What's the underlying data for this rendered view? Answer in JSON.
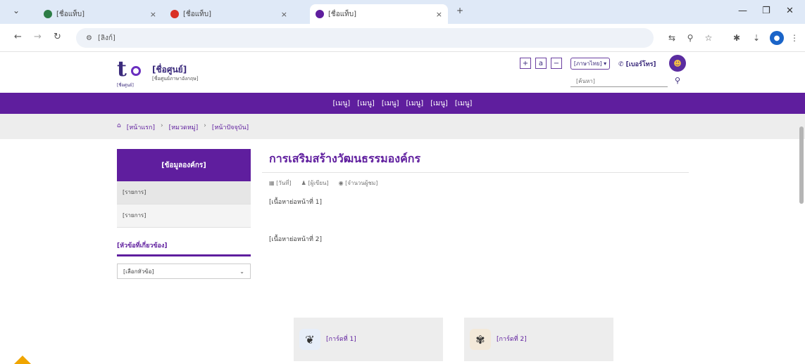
{
  "browser": {
    "tabs": [
      {
        "label": "[ชื่อแท็บ]",
        "favicon_color": "#2d7d46"
      },
      {
        "label": "[ชื่อแท็บ]",
        "favicon_color": "#d93025"
      },
      {
        "label": "[ชื่อแท็บ]",
        "favicon_color": "#5f1e9e"
      }
    ],
    "tab_close": "×",
    "new_tab": "+",
    "tab_search": "⌄",
    "window_min": "—",
    "window_max": "❐",
    "window_close": "✕",
    "url": "[ลิงก์]",
    "profile_initial": "●"
  },
  "site": {
    "logo_letter": "t",
    "logo_caption": "[ชื่อศูนย์]",
    "title": "[ชื่อศูนย์]",
    "subtitle": "[ชื่อศูนย์ภาษาอังกฤษ]",
    "font_controls": [
      "+",
      "a",
      "−"
    ],
    "language": "[ภาษาไทย] ▾",
    "hotline": "✆ [เบอร์โทร]",
    "search_placeholder": "[ค้นหา]",
    "nav": [
      "[เมนู]",
      "[เมนู]",
      "[เมนู]",
      "[เมนู]",
      "[เมนู]",
      "[เมนู]"
    ]
  },
  "breadcrumb": {
    "items": [
      "[หน้าแรก]",
      "[หมวดหมู่]",
      "[หน้าปัจจุบัน]"
    ]
  },
  "sidebar": {
    "heading": "[ข้อมูลองค์กร]",
    "items": [
      "[รายการ]",
      "[รายการ]"
    ],
    "related_label": "[หัวข้อที่เกี่ยวข้อง]",
    "select_value": "[เลือกหัวข้อ]"
  },
  "article": {
    "title": "การเสริมสร้างวัฒนธรรมองค์กร",
    "date": "[วันที่]",
    "author": "[ผู้เขียน]",
    "views": "[จำนวนผู้ชม]",
    "paragraph1": "[เนื้อหาย่อหน้าที่ 1]",
    "paragraph2": "[เนื้อหาย่อหน้าที่ 2]",
    "cards": [
      {
        "label": "[การ์ดที่ 1]",
        "icon": "❦",
        "icon_color": "#e7eef9"
      },
      {
        "label": "[การ์ดที่ 2]",
        "icon": "✾",
        "icon_color": "#f3e9d9"
      }
    ]
  }
}
